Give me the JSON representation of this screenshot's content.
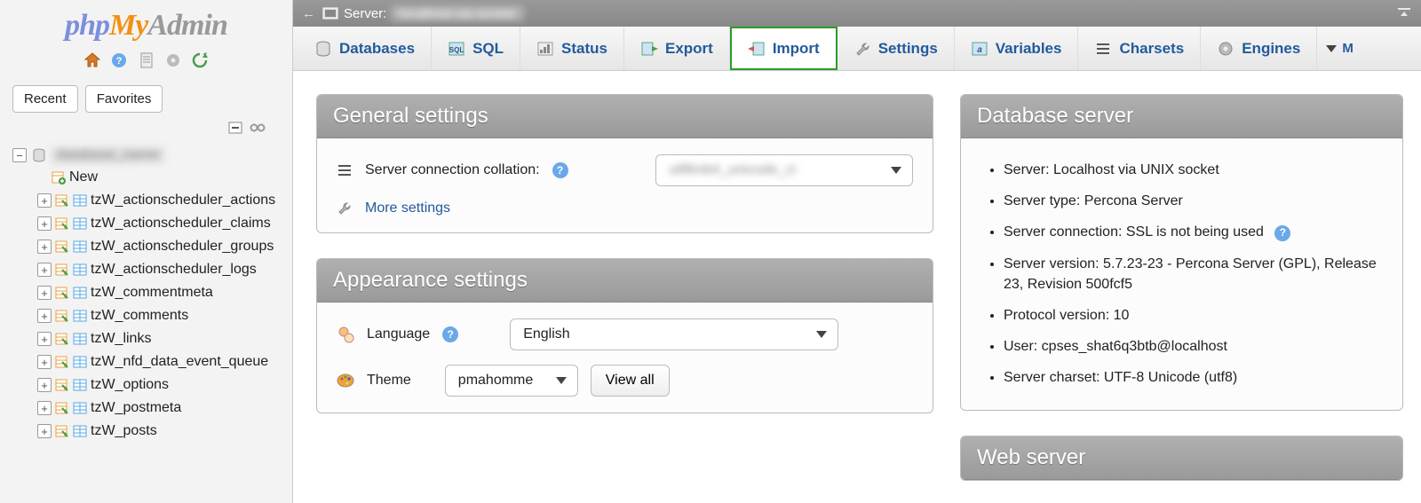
{
  "logo": {
    "php": "php",
    "my": "My",
    "admin": "Admin"
  },
  "filter_tabs": {
    "recent": "Recent",
    "favorites": "Favorites"
  },
  "tree": {
    "root_label": "database_name",
    "new_label": "New",
    "tables": [
      "tzW_actionscheduler_actions",
      "tzW_actionscheduler_claims",
      "tzW_actionscheduler_groups",
      "tzW_actionscheduler_logs",
      "tzW_commentmeta",
      "tzW_comments",
      "tzW_links",
      "tzW_nfd_data_event_queue",
      "tzW_options",
      "tzW_postmeta",
      "tzW_posts"
    ]
  },
  "topbar": {
    "server_label": "Server:",
    "server_value": "localhost via socket"
  },
  "tabs": [
    {
      "label": "Databases"
    },
    {
      "label": "SQL"
    },
    {
      "label": "Status"
    },
    {
      "label": "Export"
    },
    {
      "label": "Import"
    },
    {
      "label": "Settings"
    },
    {
      "label": "Variables"
    },
    {
      "label": "Charsets"
    },
    {
      "label": "Engines"
    }
  ],
  "more_label": "M",
  "general": {
    "title": "General settings",
    "collation_label": "Server connection collation:",
    "collation_value": "utf8mb4_unicode_ci",
    "more_settings": "More settings"
  },
  "appearance": {
    "title": "Appearance settings",
    "language_label": "Language",
    "language_value": "English",
    "theme_label": "Theme",
    "theme_value": "pmahomme",
    "view_all": "View all"
  },
  "db_server": {
    "title": "Database server",
    "items": [
      "Server: Localhost via UNIX socket",
      "Server type: Percona Server",
      "Server connection: SSL is not being used",
      "Server version: 5.7.23-23 - Percona Server (GPL), Release 23, Revision 500fcf5",
      "Protocol version: 10",
      "User: cpses_shat6q3btb@localhost",
      "Server charset: UTF-8 Unicode (utf8)"
    ],
    "ssl_help_index": 2
  },
  "web_server": {
    "title": "Web server"
  }
}
